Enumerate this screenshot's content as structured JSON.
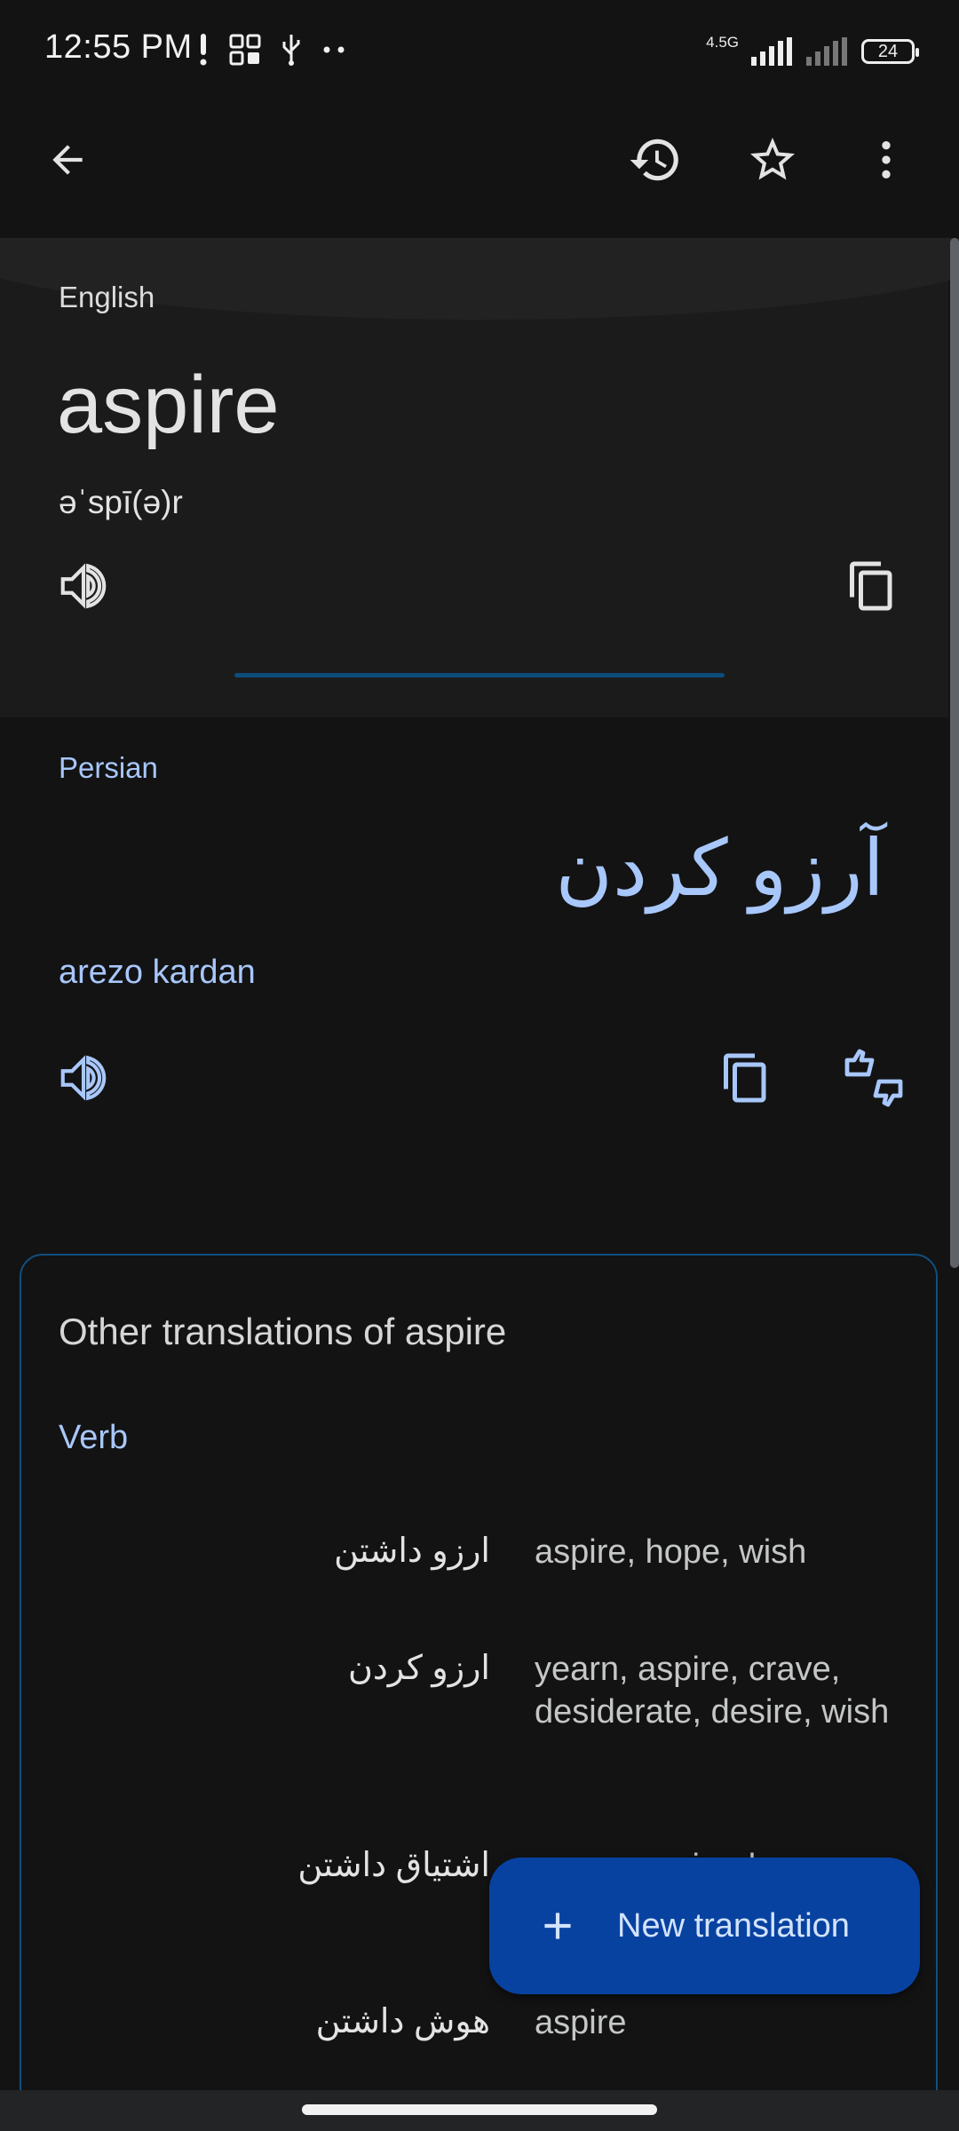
{
  "status_bar": {
    "time": "12:55 PM",
    "network": "4.5G",
    "battery": "24"
  },
  "app_bar": {
    "back_icon": "arrow-back-icon",
    "history_icon": "history-icon",
    "star_icon": "star-outline-icon",
    "more_icon": "more-vertical-icon"
  },
  "source": {
    "language": "English",
    "word": "aspire",
    "phonetic": "əˈspī(ə)r"
  },
  "target": {
    "language": "Persian",
    "word": "آرزو کردن",
    "transliteration": "arezo kardan"
  },
  "other_translations": {
    "title": "Other translations of aspire",
    "part_of_speech": "Verb",
    "rows": [
      {
        "fa": "ارزو داشتن",
        "en": "aspire, hope, wish"
      },
      {
        "fa": "ارزو کردن",
        "en": "yearn, aspire, crave, desiderate, desire, wish"
      },
      {
        "fa": "اشتیاق داشتن",
        "en": "yearn, aspire, long"
      },
      {
        "fa": "هوش داشتن",
        "en": "aspire"
      }
    ]
  },
  "fab": {
    "label": "New translation"
  },
  "colors": {
    "background": "#131314",
    "accent_blue": "#a8c7fa",
    "fab_bg": "#0842a0",
    "card_border": "#0f4f7f"
  }
}
